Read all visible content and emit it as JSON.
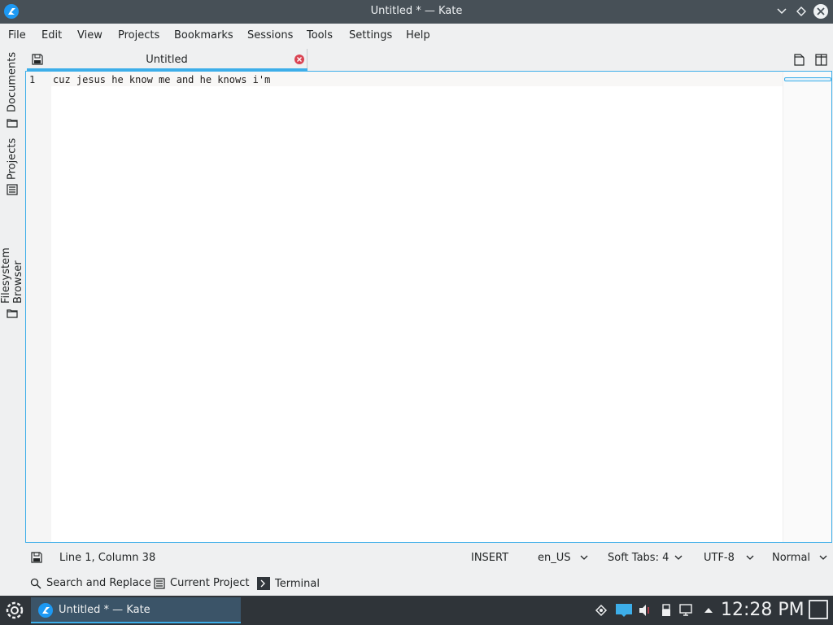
{
  "window": {
    "title": "Untitled * — Kate"
  },
  "menubar": {
    "items": [
      "File",
      "Edit",
      "View",
      "Projects",
      "Bookmarks",
      "Sessions",
      "Tools",
      "Settings",
      "Help"
    ]
  },
  "sidebar": {
    "tabs": [
      {
        "label": "Documents",
        "icon": "folder-icon"
      },
      {
        "label": "Projects",
        "icon": "list-icon"
      },
      {
        "label": "Filesystem Browser",
        "icon": "folder-icon"
      }
    ]
  },
  "tabs": [
    {
      "label": "Untitled",
      "active": true,
      "modified": true
    }
  ],
  "editor": {
    "lines": [
      {
        "number": "1",
        "text": "cuz jesus he know me and he knows i'm"
      }
    ]
  },
  "statusbar": {
    "position": "Line 1, Column 38",
    "mode": "INSERT",
    "language": "en_US",
    "tabs": "Soft Tabs: 4",
    "encoding": "UTF-8",
    "input_mode": "Normal"
  },
  "toolviews": {
    "search": "Search and Replace",
    "project": "Current Project",
    "terminal": "Terminal"
  },
  "taskbar": {
    "task_label": "Untitled * — Kate",
    "clock": "12:28 PM"
  },
  "colors": {
    "accent": "#3daee9",
    "titlebar": "#475057",
    "taskbar": "#2f3439",
    "close_red": "#da4453"
  }
}
